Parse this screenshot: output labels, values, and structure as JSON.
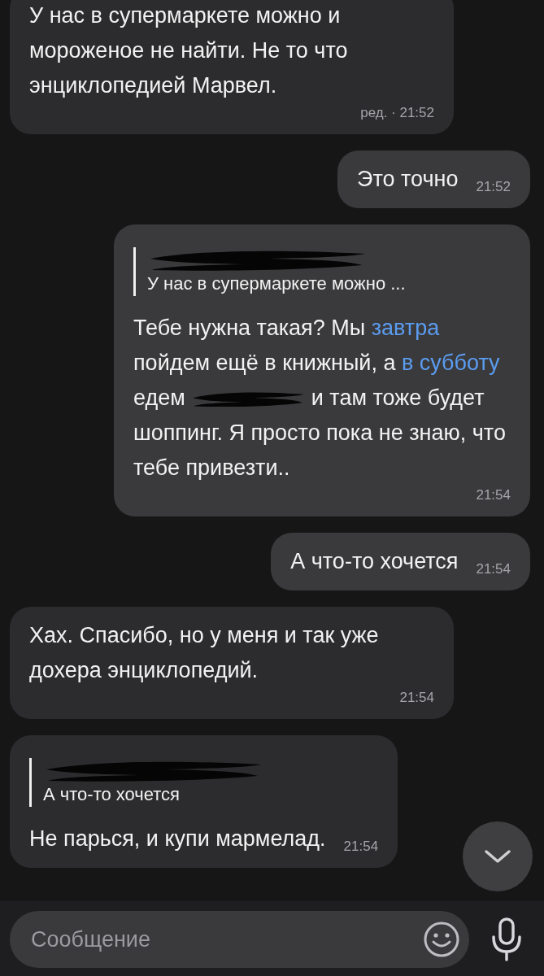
{
  "messages": [
    {
      "outgoing": false,
      "segments": [
        {
          "kind": "text",
          "text": "У нас в супермаркете можно и мороженое не найти. Не то что энциклопедией Марвел."
        }
      ],
      "time": "ред. · 21:52"
    },
    {
      "outgoing": true,
      "segments": [
        {
          "kind": "text",
          "text": "Это точно"
        }
      ],
      "time": "21:52"
    },
    {
      "outgoing": true,
      "reply": {
        "quote": "У нас в супермаркете можно ..."
      },
      "segments": [
        {
          "kind": "text",
          "text": "Тебе нужна такая? Мы "
        },
        {
          "kind": "link",
          "text": "завтра"
        },
        {
          "kind": "text",
          "text": " пойдем ещё в книжный, а "
        },
        {
          "kind": "link",
          "text": "в субботу"
        },
        {
          "kind": "text",
          "text": " едем "
        },
        {
          "kind": "redaction"
        },
        {
          "kind": "text",
          "text": " и там тоже будет шоппинг. Я просто пока не знаю, что тебе привезти.."
        }
      ],
      "time": "21:54"
    },
    {
      "outgoing": true,
      "segments": [
        {
          "kind": "text",
          "text": "А что-то хочется"
        }
      ],
      "time": "21:54"
    },
    {
      "outgoing": false,
      "segments": [
        {
          "kind": "text",
          "text": "Хах. Спасибо, но у меня и так уже дохера энциклопедий."
        }
      ],
      "time": "21:54"
    },
    {
      "outgoing": false,
      "reply": {
        "quote": "А что-то хочется"
      },
      "segments": [
        {
          "kind": "text",
          "text": "Не парься, и купи мармелад."
        }
      ],
      "time": "21:54"
    }
  ],
  "composer": {
    "placeholder": "Сообщение"
  }
}
